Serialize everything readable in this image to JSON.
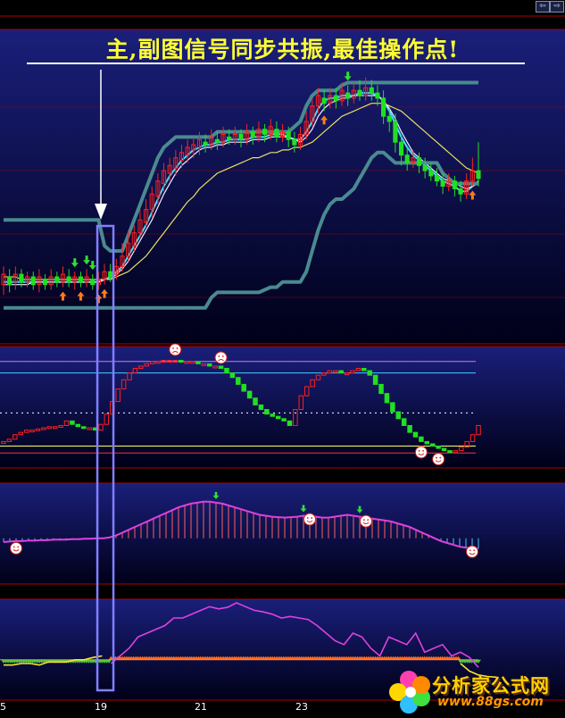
{
  "headline": "主,副图信号同步共振,最佳操作点!",
  "nav": {
    "prev_icon": "⇦",
    "next_icon": "⇨"
  },
  "x_ticks": [
    "5",
    "19",
    "21",
    "23"
  ],
  "watermark": {
    "site_name": "分析家公式网",
    "url": "www.88gs.com"
  },
  "colors": {
    "panel_bg_top": "#1a1f7a",
    "panel_bg_bottom": "#000018",
    "grid_red": "#b00000",
    "candle_up": "#ff2020",
    "candle_down": "#20e020",
    "ma_cyan": "#40e0ff",
    "ma_white": "#f0f0ff",
    "ma_yellow": "#e8e060",
    "channel": "#4a8a90",
    "osc_magenta": "#e040e0",
    "osc_yellow": "#ffe030",
    "highlight_box": "#8080ff"
  },
  "chart_data": [
    {
      "type": "candlestick",
      "panel": "main",
      "x_range": [
        0,
        100
      ],
      "y_range": [
        0,
        100
      ],
      "candles": [
        [
          17,
          21,
          13,
          24
        ],
        [
          20,
          17,
          14,
          23
        ],
        [
          18,
          21,
          15,
          24
        ],
        [
          21,
          18,
          16,
          23
        ],
        [
          18,
          20,
          16,
          22
        ],
        [
          20,
          17,
          15,
          22
        ],
        [
          17,
          20,
          14,
          23
        ],
        [
          19,
          17,
          15,
          21
        ],
        [
          17,
          20,
          15,
          23
        ],
        [
          20,
          18,
          16,
          22
        ],
        [
          18,
          21,
          16,
          24
        ],
        [
          20,
          18,
          16,
          23
        ],
        [
          18,
          20,
          15,
          22
        ],
        [
          20,
          18,
          16,
          22
        ],
        [
          18,
          20,
          16,
          23
        ],
        [
          19,
          17,
          15,
          21
        ],
        [
          17,
          19,
          15,
          22
        ],
        [
          19,
          22,
          17,
          25
        ],
        [
          22,
          20,
          18,
          25
        ],
        [
          21,
          24,
          19,
          27
        ],
        [
          24,
          28,
          22,
          33
        ],
        [
          28,
          33,
          26,
          38
        ],
        [
          32,
          37,
          30,
          40
        ],
        [
          37,
          42,
          35,
          46
        ],
        [
          41,
          46,
          39,
          50
        ],
        [
          46,
          52,
          43,
          55
        ],
        [
          51,
          57,
          48,
          60
        ],
        [
          56,
          61,
          53,
          64
        ],
        [
          60,
          63,
          57,
          66
        ],
        [
          62,
          66,
          59,
          69
        ],
        [
          65,
          68,
          62,
          71
        ],
        [
          67,
          70,
          64,
          73
        ],
        [
          69,
          71,
          66,
          74
        ],
        [
          70,
          73,
          67,
          76
        ],
        [
          72,
          71,
          68,
          75
        ],
        [
          71,
          74,
          69,
          77
        ],
        [
          73,
          72,
          69,
          76
        ],
        [
          72,
          75,
          70,
          78
        ],
        [
          74,
          73,
          71,
          77
        ],
        [
          73,
          75,
          71,
          78
        ],
        [
          75,
          73,
          70,
          77
        ],
        [
          73,
          76,
          71,
          79
        ],
        [
          76,
          74,
          71,
          78
        ],
        [
          74,
          77,
          72,
          80
        ],
        [
          77,
          75,
          72,
          79
        ],
        [
          75,
          78,
          73,
          81
        ],
        [
          77,
          74,
          72,
          80
        ],
        [
          74,
          76,
          72,
          79
        ],
        [
          76,
          73,
          70,
          78
        ],
        [
          73,
          71,
          68,
          76
        ],
        [
          71,
          75,
          69,
          78
        ],
        [
          75,
          80,
          73,
          84
        ],
        [
          80,
          86,
          78,
          89
        ],
        [
          86,
          90,
          83,
          93
        ],
        [
          89,
          87,
          84,
          92
        ],
        [
          87,
          90,
          85,
          93
        ],
        [
          90,
          88,
          85,
          93
        ],
        [
          88,
          92,
          86,
          95
        ],
        [
          91,
          89,
          86,
          94
        ],
        [
          89,
          92,
          87,
          95
        ],
        [
          92,
          90,
          88,
          96
        ],
        [
          90,
          93,
          88,
          97
        ],
        [
          93,
          91,
          88,
          96
        ],
        [
          91,
          89,
          86,
          94
        ],
        [
          89,
          82,
          79,
          92
        ],
        [
          82,
          80,
          76,
          85
        ],
        [
          80,
          72,
          68,
          83
        ],
        [
          72,
          67,
          63,
          75
        ],
        [
          67,
          64,
          61,
          70
        ],
        [
          64,
          66,
          62,
          69
        ],
        [
          66,
          63,
          60,
          68
        ],
        [
          63,
          61,
          58,
          66
        ],
        [
          61,
          59,
          57,
          64
        ],
        [
          59,
          57,
          55,
          62
        ],
        [
          57,
          55,
          52,
          60
        ],
        [
          55,
          57,
          53,
          60
        ],
        [
          57,
          54,
          51,
          59
        ],
        [
          54,
          52,
          49,
          57
        ],
        [
          52,
          57,
          50,
          60
        ],
        [
          57,
          61,
          55,
          66
        ],
        [
          61,
          58,
          55,
          72
        ]
      ],
      "lines": [
        {
          "name": "",
          "color_key": "ma_cyan",
          "values": [
            18,
            18,
            18,
            18,
            18,
            18,
            18,
            18,
            18,
            18,
            18,
            18,
            18,
            18,
            18,
            18,
            18,
            19,
            20,
            22,
            24,
            28,
            32,
            36,
            40,
            45,
            50,
            55,
            59,
            62,
            65,
            67,
            69,
            70,
            71,
            71,
            72,
            72,
            73,
            73,
            73,
            73,
            74,
            74,
            74,
            75,
            75,
            75,
            74,
            73,
            73,
            76,
            80,
            85,
            88,
            89,
            89,
            90,
            90,
            90,
            91,
            91,
            91,
            90,
            88,
            84,
            79,
            74,
            70,
            67,
            65,
            63,
            61,
            59,
            57,
            56,
            55,
            53,
            53,
            55,
            57
          ]
        },
        {
          "name": "",
          "color_key": "ma_white",
          "values": [
            17,
            17,
            17,
            17,
            17,
            18,
            18,
            18,
            18,
            18,
            18,
            18,
            18,
            18,
            18,
            18,
            18,
            19,
            19,
            21,
            23,
            26,
            30,
            34,
            38,
            42,
            47,
            52,
            56,
            60,
            63,
            65,
            67,
            69,
            70,
            70,
            71,
            71,
            72,
            72,
            72,
            72,
            73,
            73,
            73,
            74,
            74,
            74,
            74,
            73,
            72,
            74,
            77,
            82,
            85,
            87,
            88,
            89,
            89,
            90,
            90,
            90,
            90,
            90,
            88,
            85,
            81,
            76,
            72,
            68,
            66,
            64,
            62,
            60,
            58,
            57,
            56,
            55,
            54,
            55,
            56
          ]
        },
        {
          "name": "",
          "color_key": "ma_yellow",
          "values": [
            20,
            20,
            20,
            19,
            19,
            19,
            19,
            19,
            19,
            19,
            19,
            19,
            19,
            19,
            19,
            19,
            19,
            19,
            19,
            20,
            21,
            22,
            24,
            26,
            28,
            31,
            34,
            37,
            40,
            43,
            46,
            49,
            51,
            54,
            56,
            58,
            60,
            61,
            62,
            63,
            64,
            65,
            66,
            66,
            67,
            68,
            68,
            69,
            69,
            70,
            70,
            71,
            72,
            74,
            76,
            78,
            80,
            82,
            83,
            84,
            85,
            86,
            87,
            87,
            87,
            86,
            85,
            84,
            82,
            80,
            78,
            76,
            74,
            72,
            70,
            68,
            66,
            64,
            62,
            61,
            60
          ]
        },
        {
          "name": "",
          "color_key": "channel",
          "values": [
            42,
            42,
            42,
            42,
            42,
            42,
            42,
            42,
            42,
            42,
            42,
            42,
            42,
            42,
            42,
            42,
            42,
            32,
            30,
            30,
            30,
            36,
            42,
            48,
            54,
            60,
            66,
            70,
            72,
            74,
            74,
            74,
            74,
            74,
            74,
            74,
            76,
            76,
            76,
            76,
            76,
            76,
            76,
            76,
            76,
            76,
            76,
            76,
            76,
            78,
            80,
            86,
            90,
            92,
            92,
            92,
            92,
            94,
            95,
            95,
            95,
            95,
            95,
            95,
            95,
            95,
            95,
            95,
            95,
            95,
            95,
            95,
            95,
            95,
            95,
            95,
            95,
            95,
            95,
            95,
            95
          ]
        },
        {
          "name": "",
          "color_key": "channel",
          "values": [
            8,
            8,
            8,
            8,
            8,
            8,
            8,
            8,
            8,
            8,
            8,
            8,
            8,
            8,
            8,
            8,
            8,
            8,
            8,
            8,
            8,
            8,
            8,
            8,
            8,
            8,
            8,
            8,
            8,
            8,
            8,
            8,
            8,
            8,
            8,
            12,
            14,
            14,
            14,
            14,
            14,
            14,
            14,
            14,
            15,
            16,
            16,
            18,
            18,
            18,
            18,
            22,
            30,
            38,
            44,
            48,
            50,
            50,
            52,
            54,
            58,
            62,
            66,
            68,
            68,
            66,
            64,
            64,
            64,
            64,
            64,
            64,
            64,
            64,
            60,
            58,
            56,
            56,
            56,
            56,
            56
          ]
        }
      ],
      "markers": {
        "buy_arrows": [
          10,
          13,
          16,
          17,
          54,
          79
        ],
        "sell_arrows": [
          12,
          14,
          15,
          58
        ]
      },
      "highlight_x": 17
    },
    {
      "type": "bar",
      "panel": "sub1",
      "y_range": [
        0,
        100
      ],
      "values": [
        20,
        22,
        26,
        28,
        30,
        30,
        31,
        32,
        33,
        33,
        34,
        38,
        35,
        33,
        32,
        32,
        30,
        35,
        44,
        55,
        66,
        74,
        80,
        84,
        86,
        88,
        90,
        90,
        91,
        91,
        91,
        90,
        90,
        90,
        88,
        88,
        86,
        86,
        84,
        80,
        76,
        70,
        64,
        58,
        52,
        48,
        44,
        42,
        40,
        38,
        34,
        48,
        60,
        68,
        74,
        78,
        80,
        82,
        82,
        80,
        80,
        82,
        84,
        82,
        78,
        70,
        62,
        54,
        46,
        40,
        34,
        28,
        24,
        20,
        18,
        16,
        14,
        12,
        11,
        12,
        15,
        20,
        26,
        34
      ],
      "horizontal_levels": [
        90,
        80,
        45,
        16,
        10
      ],
      "faces_x": [
        30,
        38,
        73,
        76
      ]
    },
    {
      "type": "bar",
      "panel": "sub2",
      "y_range": [
        -100,
        100
      ],
      "values": [
        -18,
        -17,
        -16,
        -16,
        -15,
        -15,
        -14,
        -14,
        -13,
        -13,
        -13,
        -12,
        -12,
        -11,
        -11,
        -10,
        -10,
        -8,
        -4,
        2,
        8,
        14,
        20,
        26,
        32,
        38,
        44,
        50,
        56,
        60,
        64,
        66,
        68,
        68,
        66,
        64,
        60,
        56,
        52,
        48,
        44,
        40,
        38,
        36,
        35,
        34,
        35,
        36,
        38,
        38,
        36,
        34,
        34,
        36,
        38,
        40,
        38,
        36,
        34,
        32,
        30,
        28,
        26,
        22,
        18,
        14,
        8,
        2,
        -4,
        -10,
        -16,
        -20,
        -24,
        -28,
        -30,
        -31,
        -32
      ],
      "faces_x": [
        2,
        49,
        58,
        75
      ]
    },
    {
      "type": "line",
      "panel": "sub3",
      "y_range": [
        0,
        100
      ],
      "series": [
        {
          "name": "",
          "color_key": "osc_magenta",
          "values": [
            null,
            null,
            null,
            null,
            null,
            null,
            null,
            null,
            null,
            null,
            null,
            null,
            20,
            30,
            40,
            55,
            60,
            65,
            70,
            80,
            80,
            85,
            90,
            95,
            92,
            94,
            100,
            95,
            90,
            88,
            85,
            80,
            82,
            80,
            78,
            70,
            60,
            50,
            45,
            60,
            55,
            40,
            30,
            55,
            50,
            45,
            60,
            35,
            40,
            45,
            30,
            35,
            28,
            15
          ]
        },
        {
          "name": "",
          "color_key": "osc_yellow",
          "values": [
            18,
            18,
            20,
            20,
            18,
            22,
            22,
            22,
            25,
            25,
            28,
            30,
            null,
            null,
            null,
            null,
            null,
            null,
            null,
            null,
            null,
            null,
            null,
            null,
            null,
            null,
            null,
            null,
            null,
            null,
            null,
            null,
            null,
            null,
            null,
            null,
            null,
            null,
            null,
            null,
            null,
            null,
            null,
            null,
            null,
            null,
            null,
            null,
            null,
            null,
            null,
            20,
            10,
            5,
            3,
            2
          ]
        }
      ],
      "band_level": 25
    }
  ]
}
